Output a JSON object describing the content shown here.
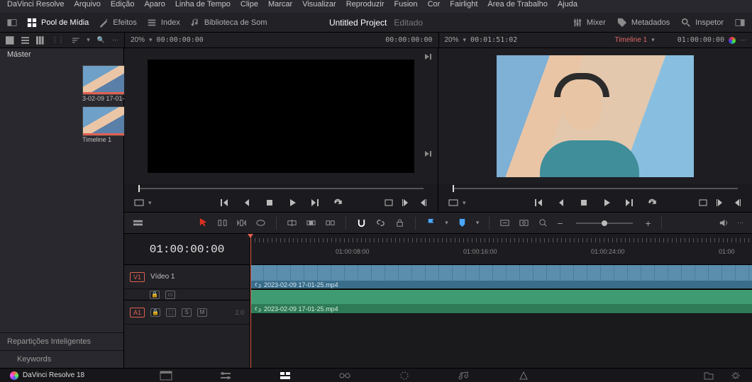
{
  "menu": [
    "DaVinci Resolve",
    "Arquivo",
    "Edição",
    "Aparo",
    "Linha de Tempo",
    "Clipe",
    "Marcar",
    "Visualizar",
    "Reproduzir",
    "Fusion",
    "Cor",
    "Fairlight",
    "Área de Trabalho",
    "Ajuda"
  ],
  "workspace": {
    "pool": "Pool de Mídia",
    "efeitos": "Efeitos",
    "index": "Index",
    "sound": "Biblioteca de Som",
    "project_title": "Untitled Project",
    "project_sub": "Editado",
    "mixer": "Mixer",
    "meta": "Metadados",
    "inspector": "Inspetor"
  },
  "tc": {
    "src_zoom": "20%",
    "src_tc": "00:00:00:00",
    "prog_tc": "00:00:00:00",
    "prog_zoom": "20%",
    "prog_dur": "00:01:51:02",
    "tl_name": "Timeline 1",
    "tl_tc": "01:00:00:00"
  },
  "sidebar": {
    "master": "Máster",
    "clip_name": "3-02-09 17-01-",
    "timeline_name": "Timeline 1",
    "smart": "Repartições Inteligentes",
    "keywords": "Keywords"
  },
  "timeline": {
    "tc": "01:00:00:00",
    "v1": "V1",
    "v1_name": "Vídeo 1",
    "a1": "A1",
    "s": "S",
    "m": "M",
    "level": "2.0",
    "clip_file": "2023-02-09 17-01-25.mp4",
    "ruler_labels": [
      "01:00:08:00",
      "01:00:16:00",
      "01:00:24:00",
      "01:00"
    ]
  },
  "footer": {
    "app": "DaVinci Resolve 18"
  }
}
